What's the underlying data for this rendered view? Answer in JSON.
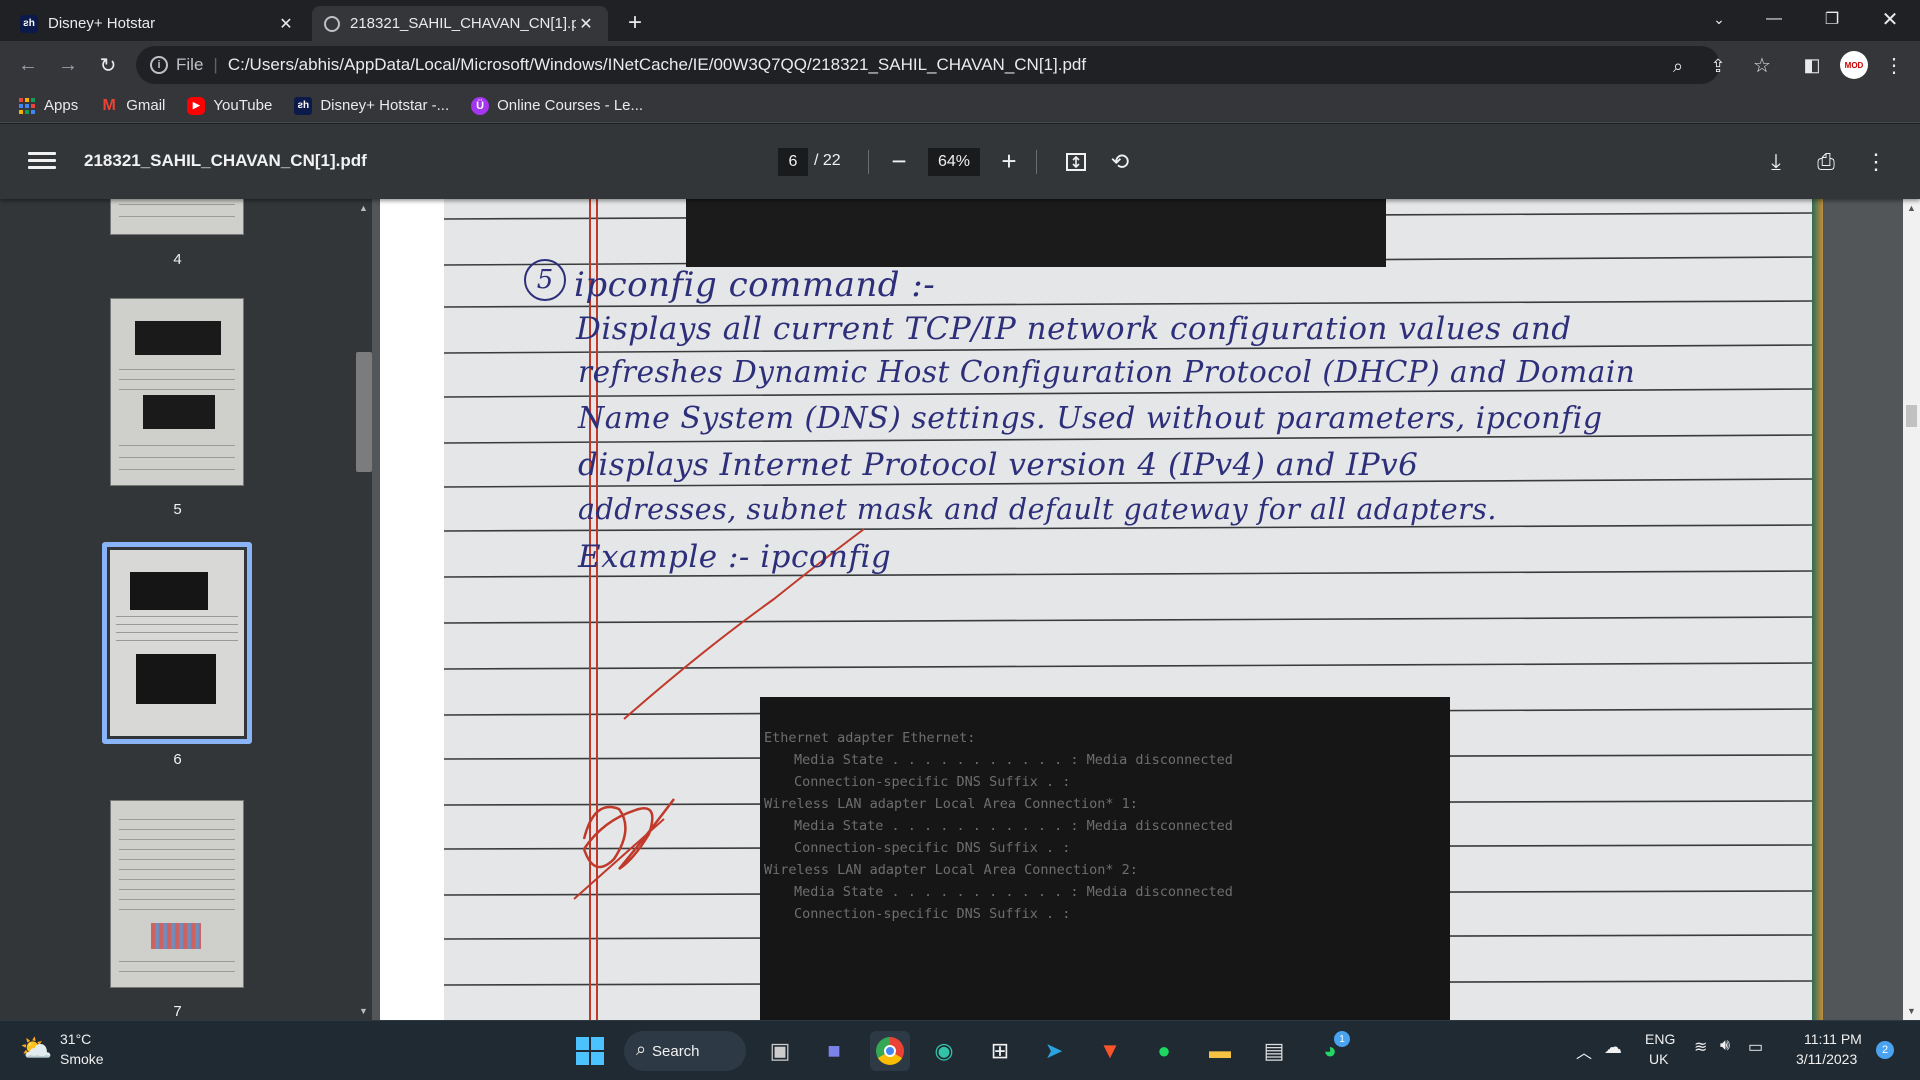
{
  "browser": {
    "tabs": [
      {
        "title": "Disney+ Hotstar",
        "favicon": "hotstar-icon",
        "active": false
      },
      {
        "title": "218321_SAHIL_CHAVAN_CN[1].p",
        "favicon": "globe-icon",
        "active": true
      }
    ],
    "address": {
      "scheme_label": "File",
      "url": "C:/Users/abhis/AppData/Local/Microsoft/Windows/INetCache/IE/00W3Q7QQ/218321_SAHIL_CHAVAN_CN[1].pdf"
    },
    "bookmarks": [
      {
        "label": "Apps",
        "icon": "apps-grid-icon"
      },
      {
        "label": "Gmail",
        "icon": "gmail-icon"
      },
      {
        "label": "YouTube",
        "icon": "youtube-icon"
      },
      {
        "label": "Disney+ Hotstar -...",
        "icon": "hotstar-icon"
      },
      {
        "label": "Online Courses - Le...",
        "icon": "udemy-icon"
      }
    ],
    "profile_badge": "MOD"
  },
  "pdf": {
    "filename": "218321_SAHIL_CHAVAN_CN[1].pdf",
    "current_page": "6",
    "total_pages": "/ 22",
    "zoom": "64%",
    "thumbnails": [
      {
        "label": "4"
      },
      {
        "label": "5"
      },
      {
        "label": "6",
        "active": true
      },
      {
        "label": "7"
      }
    ]
  },
  "document": {
    "number": "5",
    "lines": [
      "ipconfig  command :-",
      "Displays all current TCP/IP network configuration values and",
      "refreshes Dynamic Host Configuration Protocol (DHCP) and Domain",
      "Name System (DNS) settings. Used without parameters, ipconfig",
      "displays Internet Protocol version 4 (IPv4) and IPv6",
      "addresses, subnet mask and default gateway for all adapters.",
      "Example :- ipconfig"
    ],
    "terminal_lines": [
      "Ethernet adapter Ethernet:",
      "Media State . . . . . . . . . . . : Media disconnected",
      "Connection-specific DNS Suffix  . :",
      "Wireless LAN adapter Local Area Connection* 1:",
      "Media State . . . . . . . . . . . : Media disconnected",
      "Connection-specific DNS Suffix  . :",
      "Wireless LAN adapter Local Area Connection* 2:",
      "Media State . . . . . . . . . . . : Media disconnected",
      "Connection-specific DNS Suffix  . :"
    ]
  },
  "taskbar": {
    "weather_temp": "31°C",
    "weather_desc": "Smoke",
    "search_label": "Search",
    "language_top": "ENG",
    "language_bottom": "UK",
    "time": "11:11 PM",
    "date": "3/11/2023",
    "notification_count": "2",
    "whatsapp_badge": "1"
  },
  "colors": {
    "ink": "#2e2f7a",
    "accent_blue": "#8ab4f8",
    "margin_red": "#c0392b"
  }
}
